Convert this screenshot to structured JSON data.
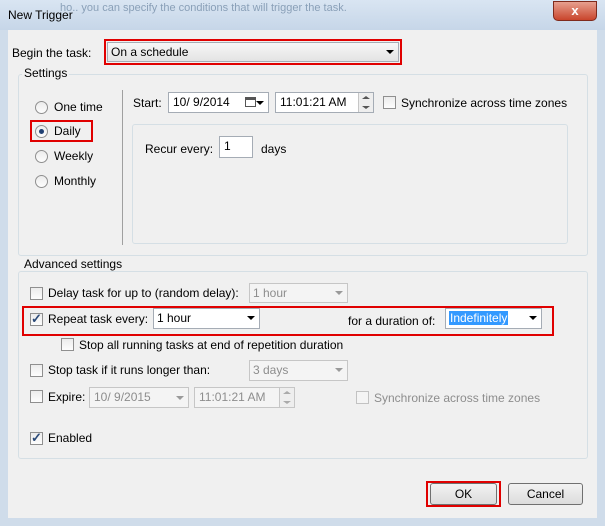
{
  "window": {
    "title": "New Trigger",
    "ghost_text": "ho.. you can specify the conditions that will trigger the task.",
    "close_glyph": "x"
  },
  "begin_task": {
    "label": "Begin the task:",
    "value": "On a schedule"
  },
  "settings": {
    "group_label": "Settings",
    "schedule_options": [
      {
        "label": "One time",
        "checked": false
      },
      {
        "label": "Daily",
        "checked": true
      },
      {
        "label": "Weekly",
        "checked": false
      },
      {
        "label": "Monthly",
        "checked": false
      }
    ],
    "start_label": "Start:",
    "start_date": "10/ 9/2014",
    "start_time": "11:01:21 AM",
    "sync_label": "Synchronize across time zones",
    "recur_label": "Recur every:",
    "recur_value": "1",
    "recur_unit": "days"
  },
  "advanced": {
    "group_label": "Advanced settings",
    "delay_label": "Delay task for up to (random delay):",
    "delay_value": "1 hour",
    "repeat_label": "Repeat task every:",
    "repeat_value": "1 hour",
    "duration_label": "for a duration of:",
    "duration_value": "Indefinitely",
    "stop_running_label": "Stop all running tasks at end of repetition duration",
    "stop_if_longer_label": "Stop task if it runs longer than:",
    "stop_if_longer_value": "3 days",
    "expire_label": "Expire:",
    "expire_date": "10/ 9/2015",
    "expire_time": "11:01:21 AM",
    "expire_sync_label": "Synchronize across time zones",
    "enabled_label": "Enabled"
  },
  "buttons": {
    "ok": "OK",
    "cancel": "Cancel"
  },
  "colors": {
    "highlight": "#e00000",
    "selection": "#3399ff"
  }
}
